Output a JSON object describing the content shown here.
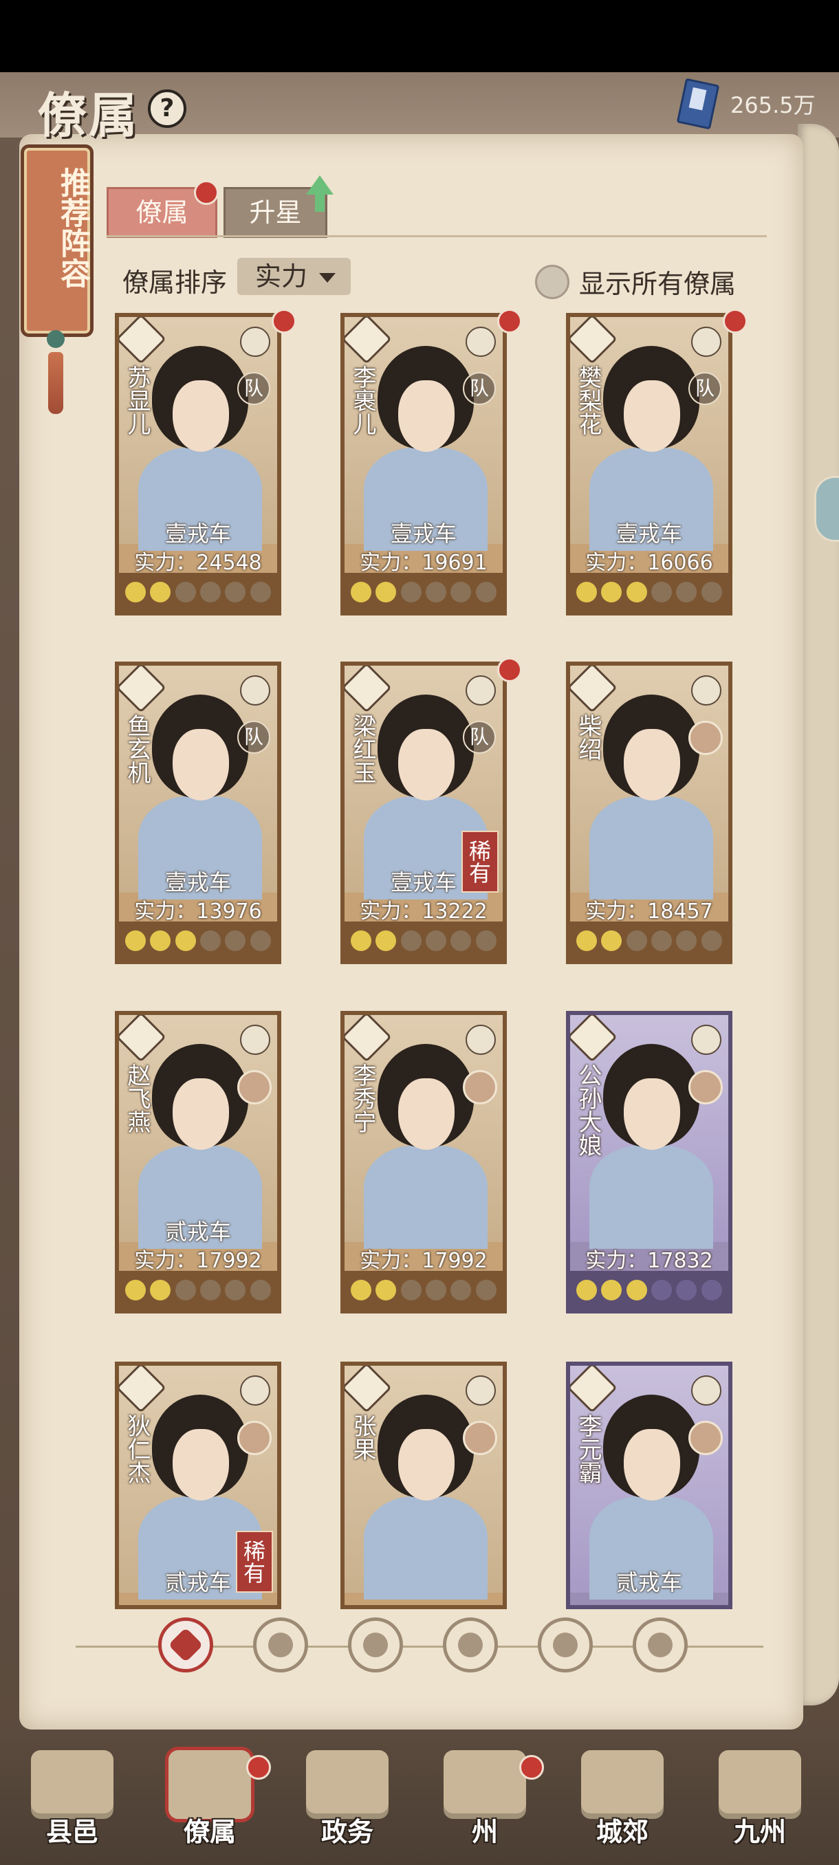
{
  "header": {
    "title": "僚属",
    "help_label": "?",
    "currency_value": "265.5万"
  },
  "banner": {
    "label": "推荐阵容"
  },
  "tabs": [
    {
      "label": "僚属",
      "active": true
    },
    {
      "label": "升星",
      "active": false
    }
  ],
  "sort": {
    "label": "僚属排序",
    "selected": "实力",
    "show_all_label": "显示所有僚属"
  },
  "cards": [
    {
      "name": "苏显儿",
      "chariot": "壹戎车",
      "power": "实力：24548",
      "team": "队",
      "stars": 2,
      "red_dot": true
    },
    {
      "name": "李裹儿",
      "chariot": "壹戎车",
      "power": "实力：19691",
      "team": "队",
      "stars": 2,
      "red_dot": true
    },
    {
      "name": "樊梨花",
      "chariot": "壹戎车",
      "power": "实力：16066",
      "team": "队",
      "stars": 3,
      "red_dot": true
    },
    {
      "name": "鱼玄机",
      "chariot": "壹戎车",
      "power": "实力：13976",
      "team": "队",
      "stars": 3,
      "red_dot": false
    },
    {
      "name": "梁红玉",
      "chariot": "壹戎车",
      "power": "实力：13222",
      "team": "队",
      "stars": 2,
      "red_dot": true,
      "rare": "稀有"
    },
    {
      "name": "柴绍",
      "chariot": "",
      "power": "实力：18457",
      "team": "",
      "stars": 2,
      "red_dot": false
    },
    {
      "name": "赵飞燕",
      "chariot": "贰戎车",
      "power": "实力：17992",
      "team": "",
      "stars": 2,
      "red_dot": false
    },
    {
      "name": "李秀宁",
      "chariot": "",
      "power": "实力：17992",
      "team": "",
      "stars": 2,
      "red_dot": false
    },
    {
      "name": "公孙大娘",
      "chariot": "",
      "power": "实力：17832",
      "team": "",
      "stars": 3,
      "red_dot": false,
      "purple": true
    },
    {
      "name": "狄仁杰",
      "chariot": "贰戎车",
      "power": "",
      "team": "",
      "stars": 0,
      "red_dot": false,
      "rare": "稀有"
    },
    {
      "name": "张果",
      "chariot": "",
      "power": "",
      "team": "",
      "stars": 0,
      "red_dot": false
    },
    {
      "name": "李元霸",
      "chariot": "贰戎车",
      "power": "",
      "team": "",
      "stars": 0,
      "red_dot": false,
      "purple": true
    }
  ],
  "filters": [
    "all-icon",
    "filter-icon-2",
    "filter-icon-3",
    "filter-icon-4",
    "filter-icon-5",
    "filter-icon-6"
  ],
  "nav": [
    {
      "label": "县邑"
    },
    {
      "label": "僚属"
    },
    {
      "label": "政务"
    },
    {
      "label": "州"
    },
    {
      "label": "城郊"
    },
    {
      "label": "九州"
    }
  ],
  "colors": {
    "accent_red": "#c53a33",
    "parchment": "#eee3cf",
    "star_on": "#e4c74e"
  }
}
